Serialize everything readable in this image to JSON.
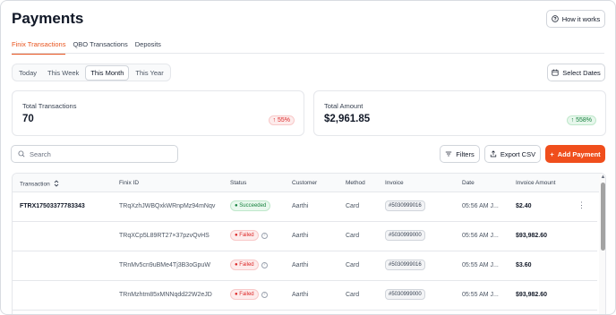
{
  "page": {
    "title": "Payments"
  },
  "header": {
    "how_it_works": "How it works",
    "info_icon": "info-circle-icon"
  },
  "tabs": [
    {
      "label": "Finix Transactions",
      "active": true
    },
    {
      "label": "QBO Transactions",
      "active": false
    },
    {
      "label": "Deposits",
      "active": false
    }
  ],
  "range": {
    "options": [
      {
        "label": "Today",
        "active": false
      },
      {
        "label": "This Week",
        "active": false
      },
      {
        "label": "This Month",
        "active": true
      },
      {
        "label": "This Year",
        "active": false
      }
    ],
    "select_dates": "Select Dates",
    "calendar_icon": "calendar-icon"
  },
  "summary": {
    "total_transactions": {
      "label": "Total Transactions",
      "value": "70",
      "change": "55%",
      "trend": "down"
    },
    "total_amount": {
      "label": "Total Amount",
      "value": "$2,961.85",
      "change": "558%",
      "trend": "up"
    }
  },
  "toolbar": {
    "search_placeholder": "Search",
    "filters": "Filters",
    "export": "Export CSV",
    "add": "Add Payment"
  },
  "table": {
    "columns": [
      "Transaction",
      "Finix ID",
      "Status",
      "Customer",
      "Method",
      "Invoice",
      "Date",
      "Invoice Amount"
    ],
    "rows": [
      {
        "transaction": "FTRX17503377783343",
        "finix_id": "TRqXzhJWBQxkWRnpMz94mNqv",
        "status": "Succeeded",
        "customer": "Aarthi",
        "method": "Card",
        "invoice": "#5030999016",
        "date": "05:56 AM J...",
        "amount": "$2.40"
      },
      {
        "transaction": "",
        "finix_id": "TRqXCp5L89RT27×37pzvQvHS",
        "status": "Failed",
        "customer": "Aarthi",
        "method": "Card",
        "invoice": "#5030999000",
        "date": "05:56 AM J...",
        "amount": "$93,982.60"
      },
      {
        "transaction": "",
        "finix_id": "TRnMv5cn9uBMe4Tj3B3oGpuW",
        "status": "Failed",
        "customer": "Aarthi",
        "method": "Card",
        "invoice": "#5030999016",
        "date": "05:55 AM J...",
        "amount": "$3.60"
      },
      {
        "transaction": "",
        "finix_id": "TRnMzhtm85xMNNqdd22W2eJD",
        "status": "Failed",
        "customer": "Aarthi",
        "method": "Card",
        "invoice": "#5030999000",
        "date": "05:55 AM J...",
        "amount": "$93,982.60"
      }
    ]
  },
  "colors": {
    "accent": "#f04e1c",
    "success": "#15803d",
    "danger": "#dc2626"
  }
}
